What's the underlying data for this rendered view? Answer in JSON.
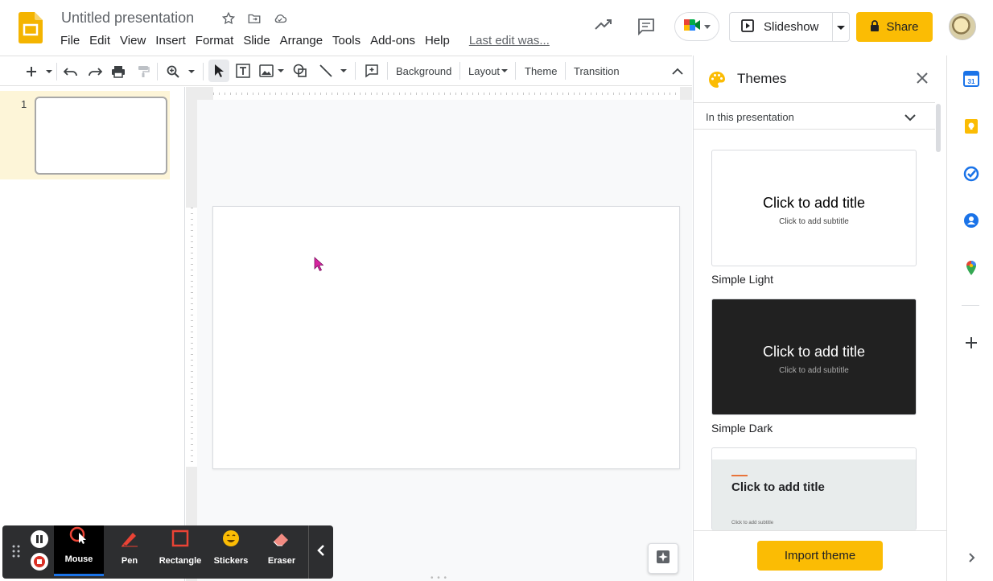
{
  "header": {
    "title": "Untitled presentation",
    "menu": [
      "File",
      "Edit",
      "View",
      "Insert",
      "Format",
      "Slide",
      "Arrange",
      "Tools",
      "Add-ons",
      "Help"
    ],
    "last_edit": "Last edit was...",
    "slideshow_label": "Slideshow",
    "share_label": "Share"
  },
  "toolbar": {
    "background_label": "Background",
    "layout_label": "Layout",
    "theme_label": "Theme",
    "transition_label": "Transition"
  },
  "filmstrip": {
    "slide_number": "1"
  },
  "annotation_toolbar": {
    "tools": [
      "Mouse",
      "Pen",
      "Rectangle",
      "Stickers",
      "Eraser"
    ],
    "active_tool": "Mouse"
  },
  "themes_panel": {
    "title": "Themes",
    "filter_label": "In this presentation",
    "themes": [
      {
        "name": "Simple Light",
        "title_text": "Click to add title",
        "subtitle_text": "Click to add subtitle"
      },
      {
        "name": "Simple Dark",
        "title_text": "Click to add title",
        "subtitle_text": "Click to add subtitle"
      },
      {
        "name": "",
        "title_text": "Click to add title",
        "subtitle_text": "Click to add subtitle"
      }
    ],
    "import_label": "Import theme"
  },
  "side_apps": {
    "calendar_day": "31"
  },
  "colors": {
    "accent_yellow": "#fbbc04",
    "film_selected_bg": "#fdf5d8",
    "active_tool_bar": "#1a73e8"
  }
}
